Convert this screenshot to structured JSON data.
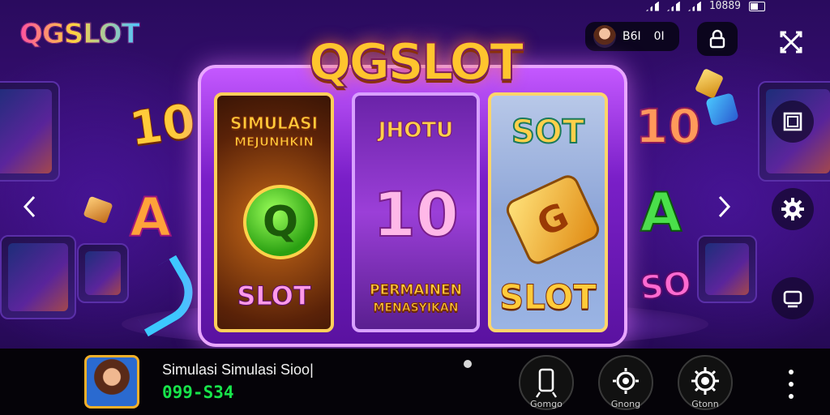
{
  "app": {
    "logo_text": "QGSLOT"
  },
  "status_bar": {
    "time_text": "10889"
  },
  "profile": {
    "value_a": "B6I",
    "value_b": "0I"
  },
  "game": {
    "title": "QGSLOT",
    "reel1": {
      "top_line1": "SIMULASI",
      "top_line2": "MEJUNHKIN",
      "bottom": "SLOT"
    },
    "reel2": {
      "top": "JHOTU",
      "middle": "10",
      "bottom_line1": "PERMAINEN",
      "bottom_line2": "MENASYIKAN"
    },
    "reel3": {
      "top": "SOT",
      "bottom": "SLOT"
    },
    "floating": {
      "left_10": "10",
      "left_A": "A",
      "right_10": "10",
      "right_A": "A",
      "right_so": "SO"
    }
  },
  "bottom_bar": {
    "title": "Simulasi Simulasi Sioo|",
    "code": "099-S34",
    "controls": [
      {
        "label": "Gomgo",
        "icon": "phone-icon"
      },
      {
        "label": "Gnong",
        "icon": "gear-icon"
      },
      {
        "label": "Gtonn",
        "icon": "gear-icon"
      }
    ]
  },
  "colors": {
    "accent_gold": "#ffc52e",
    "accent_green": "#17e44a",
    "frame_purple": "#7a1fc8"
  }
}
